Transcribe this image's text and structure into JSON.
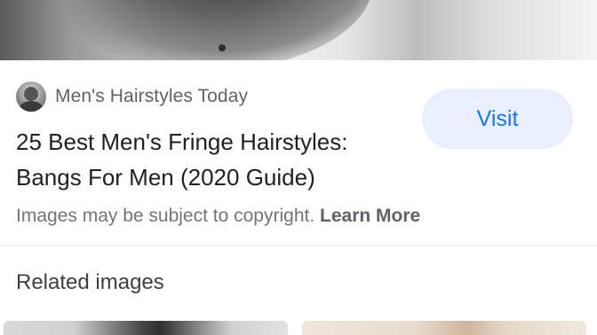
{
  "result": {
    "source": {
      "name": "Men's Hairstyles Today",
      "icon": "site-avatar-icon"
    },
    "title_line1": "25 Best Men's Fringe Hairstyles:",
    "title_line2": "Bangs For Men (2020 Guide)",
    "visit_label": "Visit",
    "copyright_text": "Images may be subject to copyright.",
    "learn_more_label": "Learn More"
  },
  "related": {
    "heading": "Related images"
  },
  "colors": {
    "accent": "#1a73e8",
    "visit_bg": "#e8f0fe",
    "title": "#202124",
    "secondary_text": "#70757a",
    "divider": "#e8eaed"
  }
}
